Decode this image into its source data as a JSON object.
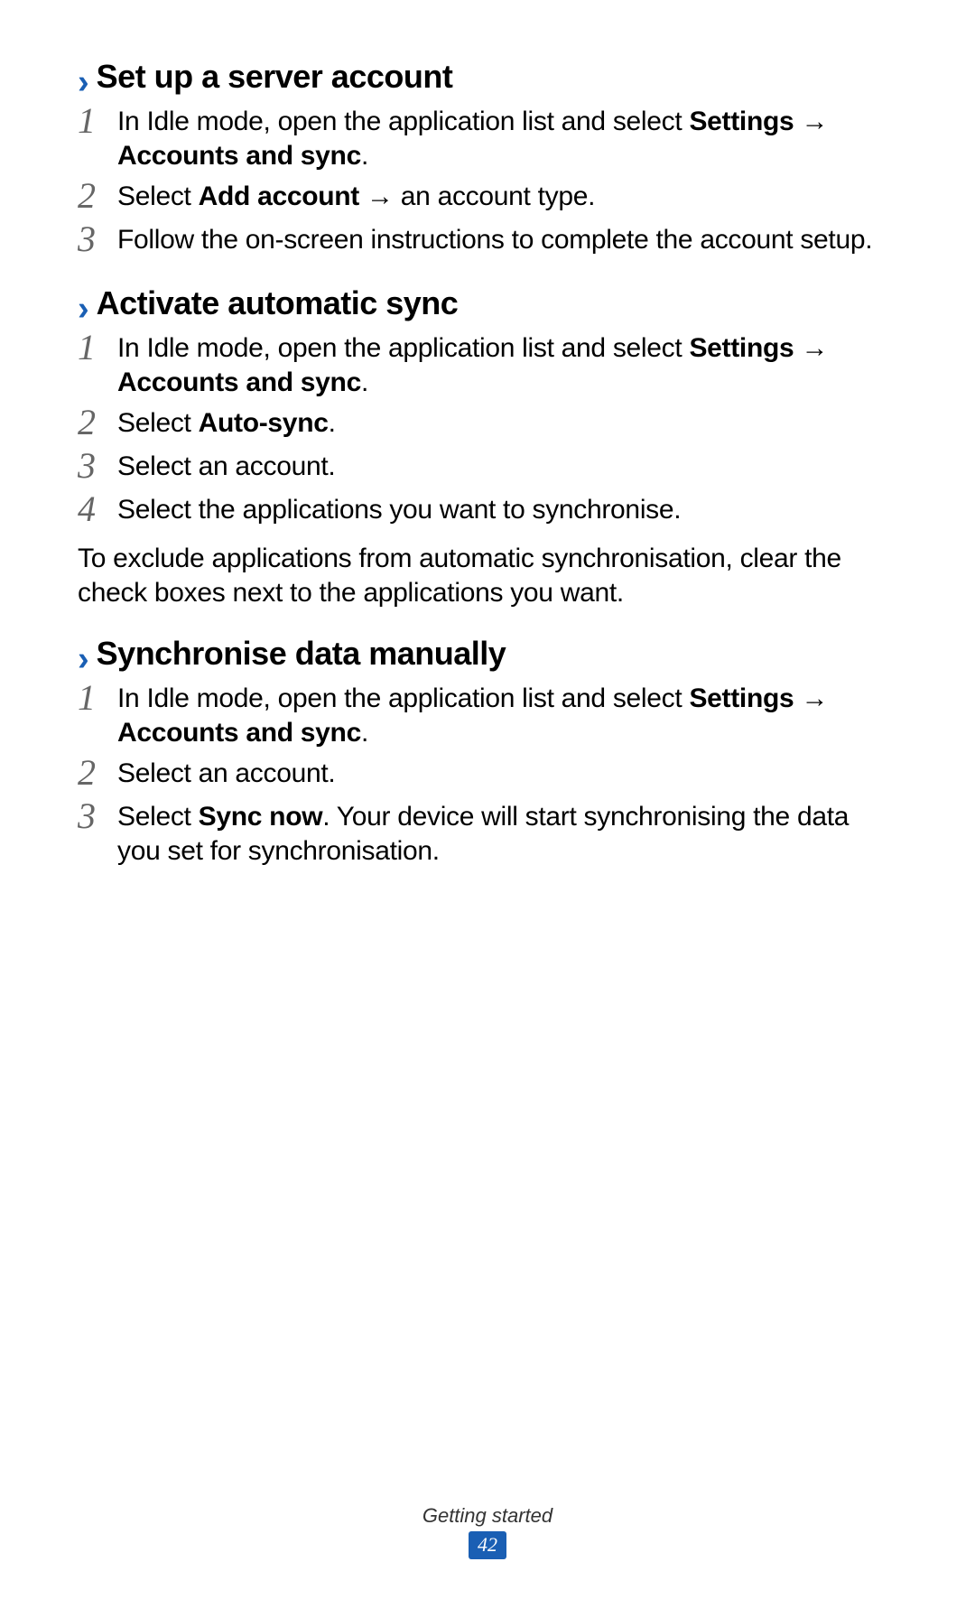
{
  "sections": [
    {
      "chevron": "›",
      "title": "Set up a server account",
      "steps": [
        {
          "num": "1",
          "parts": [
            "In Idle mode, open the application list and select ",
            "Settings",
            " → ",
            "Accounts and sync",
            "."
          ]
        },
        {
          "num": "2",
          "parts": [
            "Select ",
            "Add account",
            " → an account type."
          ]
        },
        {
          "num": "3",
          "parts": [
            "Follow the on-screen instructions to complete the account setup."
          ]
        }
      ],
      "note": ""
    },
    {
      "chevron": "›",
      "title": "Activate automatic sync",
      "steps": [
        {
          "num": "1",
          "parts": [
            "In Idle mode, open the application list and select ",
            "Settings",
            " → ",
            "Accounts and sync",
            "."
          ]
        },
        {
          "num": "2",
          "parts": [
            "Select ",
            "Auto-sync",
            "."
          ]
        },
        {
          "num": "3",
          "parts": [
            "Select an account."
          ]
        },
        {
          "num": "4",
          "parts": [
            "Select the applications you want to synchronise."
          ]
        }
      ],
      "note": "To exclude applications from automatic synchronisation, clear the check boxes next to the applications you want."
    },
    {
      "chevron": "›",
      "title": "Synchronise data manually",
      "steps": [
        {
          "num": "1",
          "parts": [
            "In Idle mode, open the application list and select ",
            "Settings",
            " → ",
            "Accounts and sync",
            "."
          ]
        },
        {
          "num": "2",
          "parts": [
            "Select an account."
          ]
        },
        {
          "num": "3",
          "parts": [
            "Select ",
            "Sync now",
            ". Your device will start synchronising the data you set for synchronisation."
          ]
        }
      ],
      "note": ""
    }
  ],
  "footer": {
    "label": "Getting started",
    "page": "42"
  }
}
